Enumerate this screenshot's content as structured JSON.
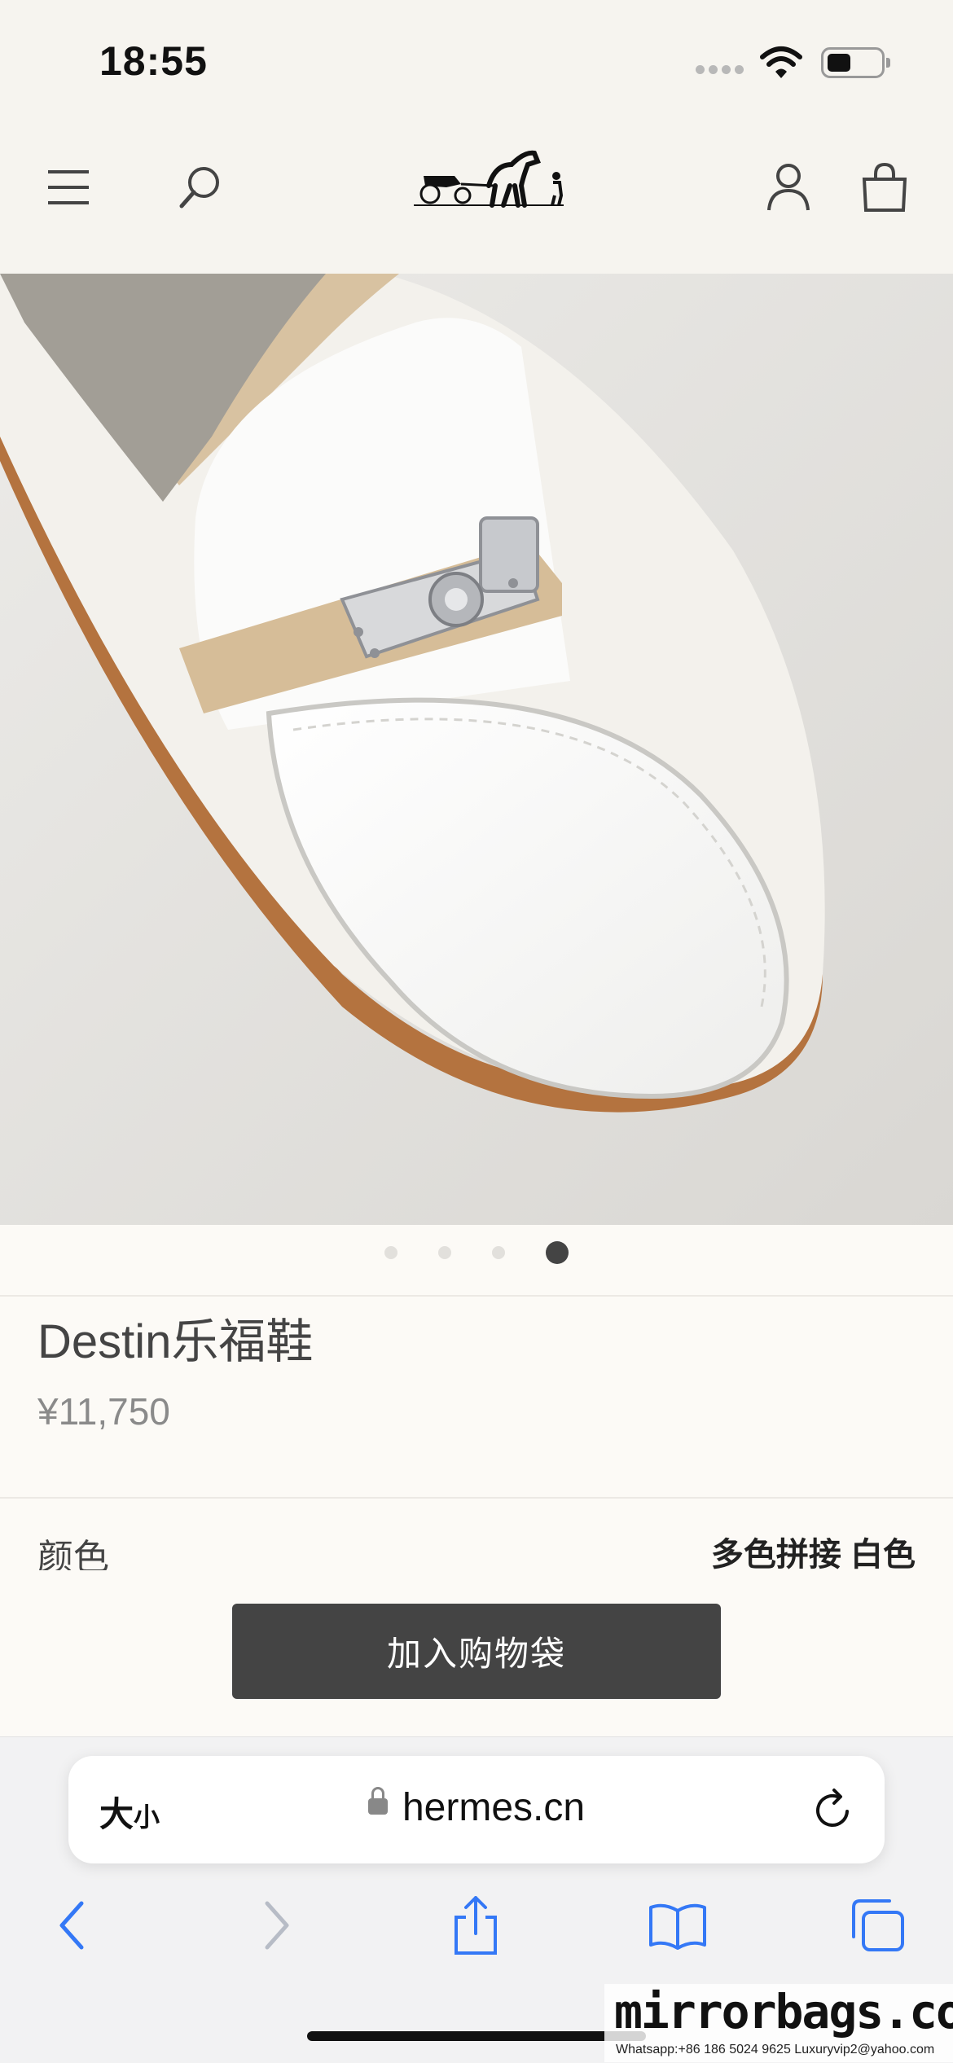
{
  "status_bar": {
    "time": "18:55",
    "battery_level": 0.42
  },
  "header": {
    "menu_icon": "hamburger-menu-icon",
    "search_icon": "search-icon",
    "logo_icon": "hermes-carriage-logo",
    "account_icon": "account-icon",
    "bag_icon": "shopping-bag-icon"
  },
  "carousel": {
    "slide_count": 4,
    "active_index": 3
  },
  "product": {
    "title": "Destin乐福鞋",
    "price": "¥11,750",
    "color_label": "颜色",
    "color_value": "多色拼接 白色"
  },
  "cta": {
    "add_to_bag": "加入购物袋"
  },
  "browser": {
    "text_size": "大",
    "text_size_small": "小",
    "host": "hermes.cn",
    "toolbar": [
      "back-icon",
      "forward-icon",
      "share-icon",
      "bookmarks-icon",
      "tabs-icon"
    ]
  },
  "watermark": {
    "title": "mirrorbags.com",
    "contact": "Whatsapp:+86 186 5024 9625   Luxuryvip2@yahoo.com"
  },
  "colors": {
    "accent": "#3478f6",
    "button": "#444444",
    "background": "#fcfaf6"
  }
}
